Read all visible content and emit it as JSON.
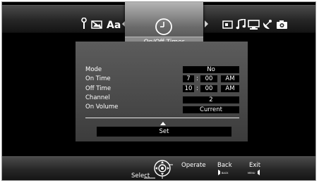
{
  "menu_bar": {
    "icons": [
      "wrench-icon",
      "picture-off-icon",
      "aa-caption-icon",
      "screen-icon",
      "music-note-icon",
      "monitor-icon",
      "satellite-dish-icon",
      "camera-icon"
    ],
    "aa_label": "Aa",
    "selected_item": {
      "icon": "clock-icon",
      "label": "On/Off Timer"
    }
  },
  "timer_panel": {
    "rows": [
      {
        "label": "Mode",
        "value": "No"
      },
      {
        "label": "On Time",
        "hour": "7",
        "minute": "00",
        "ampm": "AM"
      },
      {
        "label": "Off Time",
        "hour": "10",
        "minute": "00",
        "ampm": "AM"
      },
      {
        "label": "Channel",
        "value": "2"
      },
      {
        "label": "On Volume",
        "value": "Current"
      }
    ],
    "time_separator": ":",
    "set_label": "Set"
  },
  "guide_bar": {
    "operate_label": "Operate",
    "select_label": "Select",
    "back_label": "Back",
    "back_key": "BACK",
    "exit_label": "Exit",
    "exit_key": "MENU"
  },
  "colors": {
    "menu_bar": "#2a2a2a",
    "selected_tile": "#8a8a8a",
    "panel": "#4a4a4a",
    "field_bg": "#000000",
    "text": "#ffffff"
  }
}
